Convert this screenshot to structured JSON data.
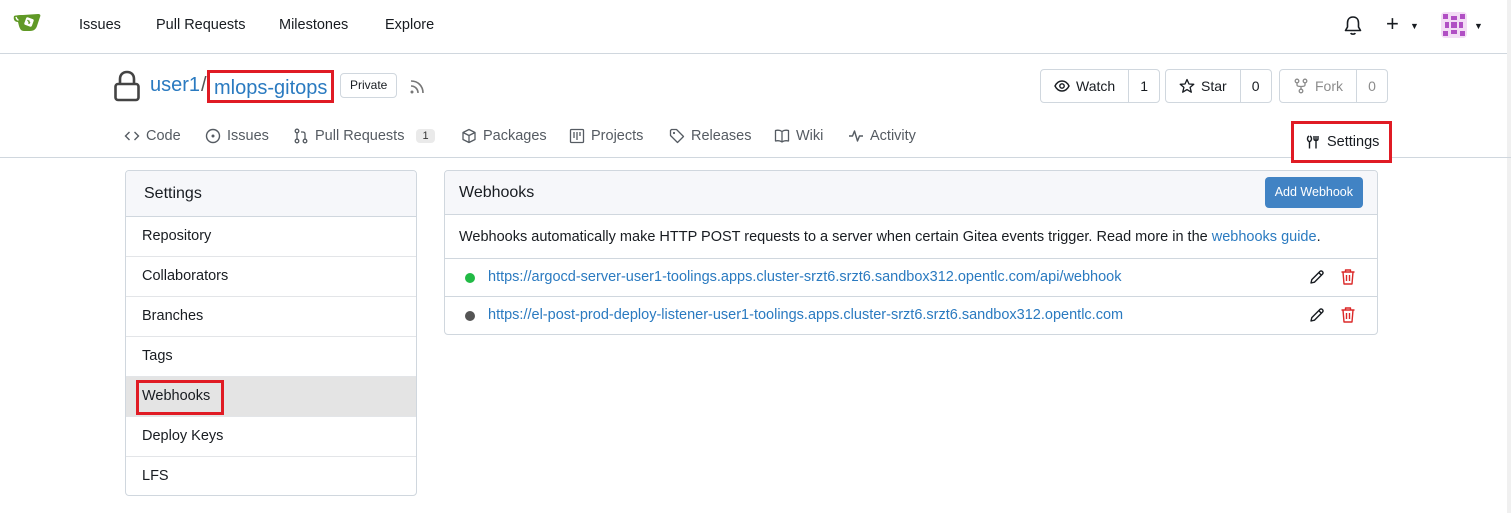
{
  "topnav": {
    "links": [
      "Issues",
      "Pull Requests",
      "Milestones",
      "Explore"
    ]
  },
  "repo": {
    "owner": "user1",
    "separator": "/",
    "name": "mlops-gitops",
    "visibility": "Private",
    "watch": {
      "label": "Watch",
      "count": "1"
    },
    "star": {
      "label": "Star",
      "count": "0"
    },
    "fork": {
      "label": "Fork",
      "count": "0"
    }
  },
  "tabs": {
    "code": "Code",
    "issues": "Issues",
    "pulls": "Pull Requests",
    "pulls_count": "1",
    "packages": "Packages",
    "projects": "Projects",
    "releases": "Releases",
    "wiki": "Wiki",
    "activity": "Activity",
    "settings": "Settings"
  },
  "sidebar": {
    "title": "Settings",
    "items": [
      "Repository",
      "Collaborators",
      "Branches",
      "Tags",
      "Webhooks",
      "Deploy Keys",
      "LFS"
    ],
    "active": "Webhooks"
  },
  "webhooks": {
    "title": "Webhooks",
    "add_label": "Add Webhook",
    "desc_text": "Webhooks automatically make HTTP POST requests to a server when certain Gitea events trigger. Read more in the ",
    "desc_link": "webhooks guide",
    "desc_end": ".",
    "hooks": [
      {
        "url": "https://argocd-server-user1-toolings.apps.cluster-srzt6.srzt6.sandbox312.opentlc.com/api/webhook",
        "status_color": "#21ba45"
      },
      {
        "url": "https://el-post-prod-deploy-listener-user1-toolings.apps.cluster-srzt6.srzt6.sandbox312.opentlc.com",
        "status_color": "#555555"
      }
    ]
  },
  "colors": {
    "accent": "#4183c4",
    "link": "#2a7ac0",
    "highlight_box": "#e01b24",
    "delete": "#db2828"
  }
}
